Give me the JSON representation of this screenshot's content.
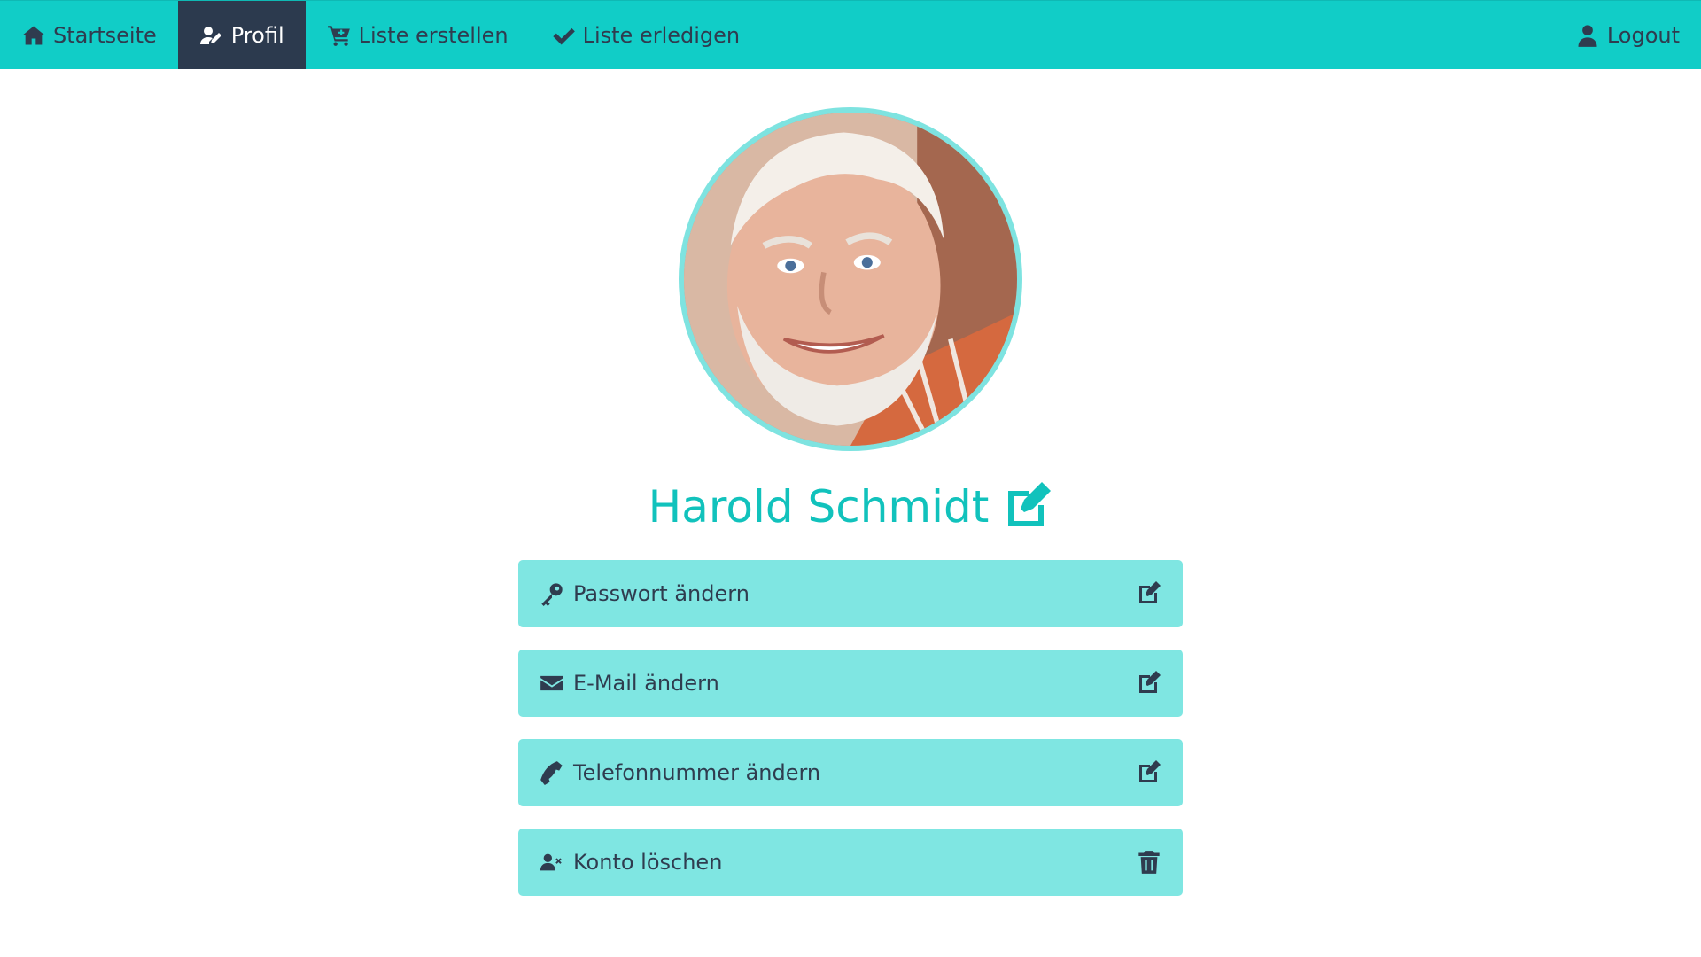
{
  "nav": {
    "items": [
      {
        "label": "Startseite",
        "icon": "home-icon"
      },
      {
        "label": "Profil",
        "icon": "user-edit-icon",
        "active": true
      },
      {
        "label": "Liste erstellen",
        "icon": "cart-plus-icon"
      },
      {
        "label": "Liste erledigen",
        "icon": "check-icon"
      }
    ],
    "logout": {
      "label": "Logout",
      "icon": "user-icon"
    }
  },
  "profile": {
    "name": "Harold Schmidt",
    "avatar_alt": "profile photo"
  },
  "actions": [
    {
      "label": "Passwort ändern",
      "icon": "key-icon",
      "trail_icon": "edit-icon"
    },
    {
      "label": "E-Mail ändern",
      "icon": "envelope-icon",
      "trail_icon": "edit-icon"
    },
    {
      "label": "Telefonnummer ändern",
      "icon": "phone-icon",
      "trail_icon": "edit-icon"
    },
    {
      "label": "Konto löschen",
      "icon": "user-times-icon",
      "trail_icon": "trash-icon"
    }
  ],
  "colors": {
    "accent": "#11cdc7",
    "active_nav": "#2c3a4e",
    "card_bg": "#7fe6e2",
    "text_dark": "#2f3c4f"
  }
}
